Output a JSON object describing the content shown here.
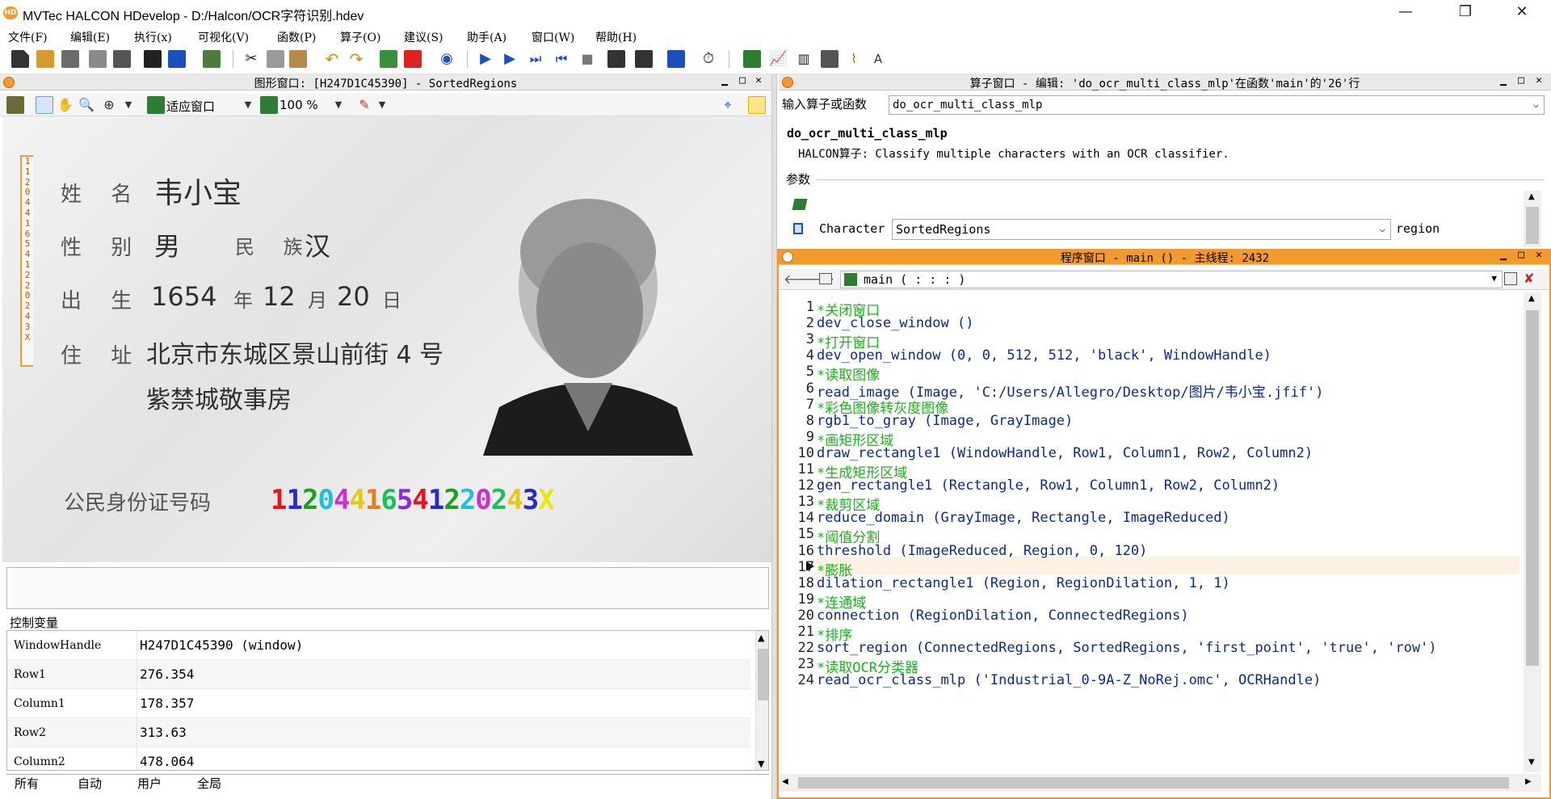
{
  "app": {
    "title": "MVTec HALCON HDevelop - D:/Halcon/OCR字符识别.hdev",
    "icon_text": "HD"
  },
  "menu": [
    "文件(F)",
    "编辑(E)",
    "执行(x)",
    "可视化(V)",
    "函数(P)",
    "算子(O)",
    "建议(S)",
    "助手(A)",
    "窗口(W)",
    "帮助(H)"
  ],
  "graphics_window": {
    "title": "图形窗口: [H247D1C45390] - SortedRegions",
    "zoom_mode": "适应窗口",
    "zoom_percent": "100 %",
    "image": {
      "name_label": "姓 名",
      "name_value": "韦小宝",
      "sex_label": "性 别",
      "sex_value": "男",
      "ethnic_label": "民 族",
      "ethnic_value": "汉",
      "birth_label": "出 生",
      "birth_year": "1654",
      "birth_year_unit": "年",
      "birth_month": "12",
      "birth_month_unit": "月",
      "birth_day": "20",
      "birth_day_unit": "日",
      "addr_label": "住 址",
      "addr_line1": "北京市东城区景山前街 4 号",
      "addr_line2": "紫禁城敬事房",
      "id_label": "公民身份证号码",
      "id_number": [
        "1",
        "1",
        "2",
        "0",
        "4",
        "4",
        "1",
        "6",
        "5",
        "4",
        "1",
        "2",
        "2",
        "0",
        "2",
        "4",
        "3",
        "X"
      ],
      "id_colors": [
        "#e8121c",
        "#2a27d6",
        "#1aa01a",
        "#1fbfe0",
        "#d22bd6",
        "#e6c814",
        "#e87a18",
        "#1ac058",
        "#8a2be2",
        "#e8121c",
        "#2a27d6",
        "#1aa01a",
        "#1fbfe0",
        "#d22bd6",
        "#1ac058",
        "#e6c814",
        "#2a27d6",
        "#e8e800"
      ],
      "ruler_chars": [
        "1",
        "1",
        "2",
        "0",
        "4",
        "4",
        "1",
        "6",
        "5",
        "4",
        "1",
        "2",
        "2",
        "0",
        "2",
        "4",
        "3",
        "X"
      ]
    }
  },
  "control_variables": {
    "title": "控制变量",
    "rows": [
      {
        "name": "WindowHandle",
        "value": "H247D1C45390 (window)"
      },
      {
        "name": "Row1",
        "value": "276.354"
      },
      {
        "name": "Column1",
        "value": "178.357"
      },
      {
        "name": "Row2",
        "value": "313.63"
      },
      {
        "name": "Column2",
        "value": "478.064"
      }
    ],
    "tabs": [
      "所有",
      "自动",
      "用户",
      "全局"
    ]
  },
  "operator_window": {
    "title": "算子窗口 - 编辑: 'do_ocr_multi_class_mlp'在函数'main'的'26'行",
    "input_label": "输入算子或函数",
    "input_value": "do_ocr_multi_class_mlp",
    "op_name": "do_ocr_multi_class_mlp",
    "op_desc": "HALCON算子: Classify multiple characters with an OCR classifier.",
    "params_label": "参数",
    "param": {
      "name": "Character",
      "value": "SortedRegions",
      "type": "region"
    }
  },
  "program_window": {
    "title": "程序窗口 - main () - 主线程: 2432",
    "procedure": "main ( : : : )",
    "lines": [
      {
        "n": "1",
        "text": "*关闭窗口",
        "comment": true
      },
      {
        "n": "2",
        "text": "dev_close_window ()",
        "comment": false
      },
      {
        "n": "3",
        "text": "*打开窗口",
        "comment": true
      },
      {
        "n": "4",
        "text": "dev_open_window (0, 0, 512, 512, 'black', WindowHandle)",
        "comment": false
      },
      {
        "n": "5",
        "text": "*读取图像",
        "comment": true
      },
      {
        "n": "6",
        "text": "read_image (Image, 'C:/Users/Allegro/Desktop/图片/韦小宝.jfif')",
        "comment": false
      },
      {
        "n": "7",
        "text": "*彩色图像转灰度图像",
        "comment": true
      },
      {
        "n": "8",
        "text": "rgb1_to_gray (Image, GrayImage)",
        "comment": false
      },
      {
        "n": "9",
        "text": "*画矩形区域",
        "comment": true
      },
      {
        "n": "10",
        "text": "draw_rectangle1 (WindowHandle, Row1, Column1, Row2, Column2)",
        "comment": false
      },
      {
        "n": "11",
        "text": "*生成矩形区域",
        "comment": true
      },
      {
        "n": "12",
        "text": "gen_rectangle1 (Rectangle, Row1, Column1, Row2, Column2)",
        "comment": false
      },
      {
        "n": "13",
        "text": "*裁剪区域",
        "comment": true
      },
      {
        "n": "14",
        "text": "reduce_domain (GrayImage, Rectangle, ImageReduced)",
        "comment": false
      },
      {
        "n": "15",
        "text": "*阈值分割",
        "comment": true
      },
      {
        "n": "16",
        "text": "threshold (ImageReduced, Region, 0, 120)",
        "comment": false
      },
      {
        "n": "17",
        "text": "*膨胀",
        "comment": true
      },
      {
        "n": "18",
        "text": "dilation_rectangle1 (Region, RegionDilation, 1, 1)",
        "comment": false
      },
      {
        "n": "19",
        "text": "*连通域",
        "comment": true
      },
      {
        "n": "20",
        "text": "connection (RegionDilation, ConnectedRegions)",
        "comment": false
      },
      {
        "n": "21",
        "text": "*排序",
        "comment": true
      },
      {
        "n": "22",
        "text": "sort_region (ConnectedRegions, SortedRegions, 'first_point', 'true', 'row')",
        "comment": false
      },
      {
        "n": "23",
        "text": "*读取OCR分类器",
        "comment": true
      },
      {
        "n": "24",
        "text": "read_ocr_class_mlp ('Industrial_0-9A-Z_NoRej.omc', OCRHandle)",
        "comment": false
      }
    ]
  },
  "colors": {
    "accent": "#f29a2e",
    "code_text": "#0c2b85",
    "code_comment": "#1db01d"
  }
}
